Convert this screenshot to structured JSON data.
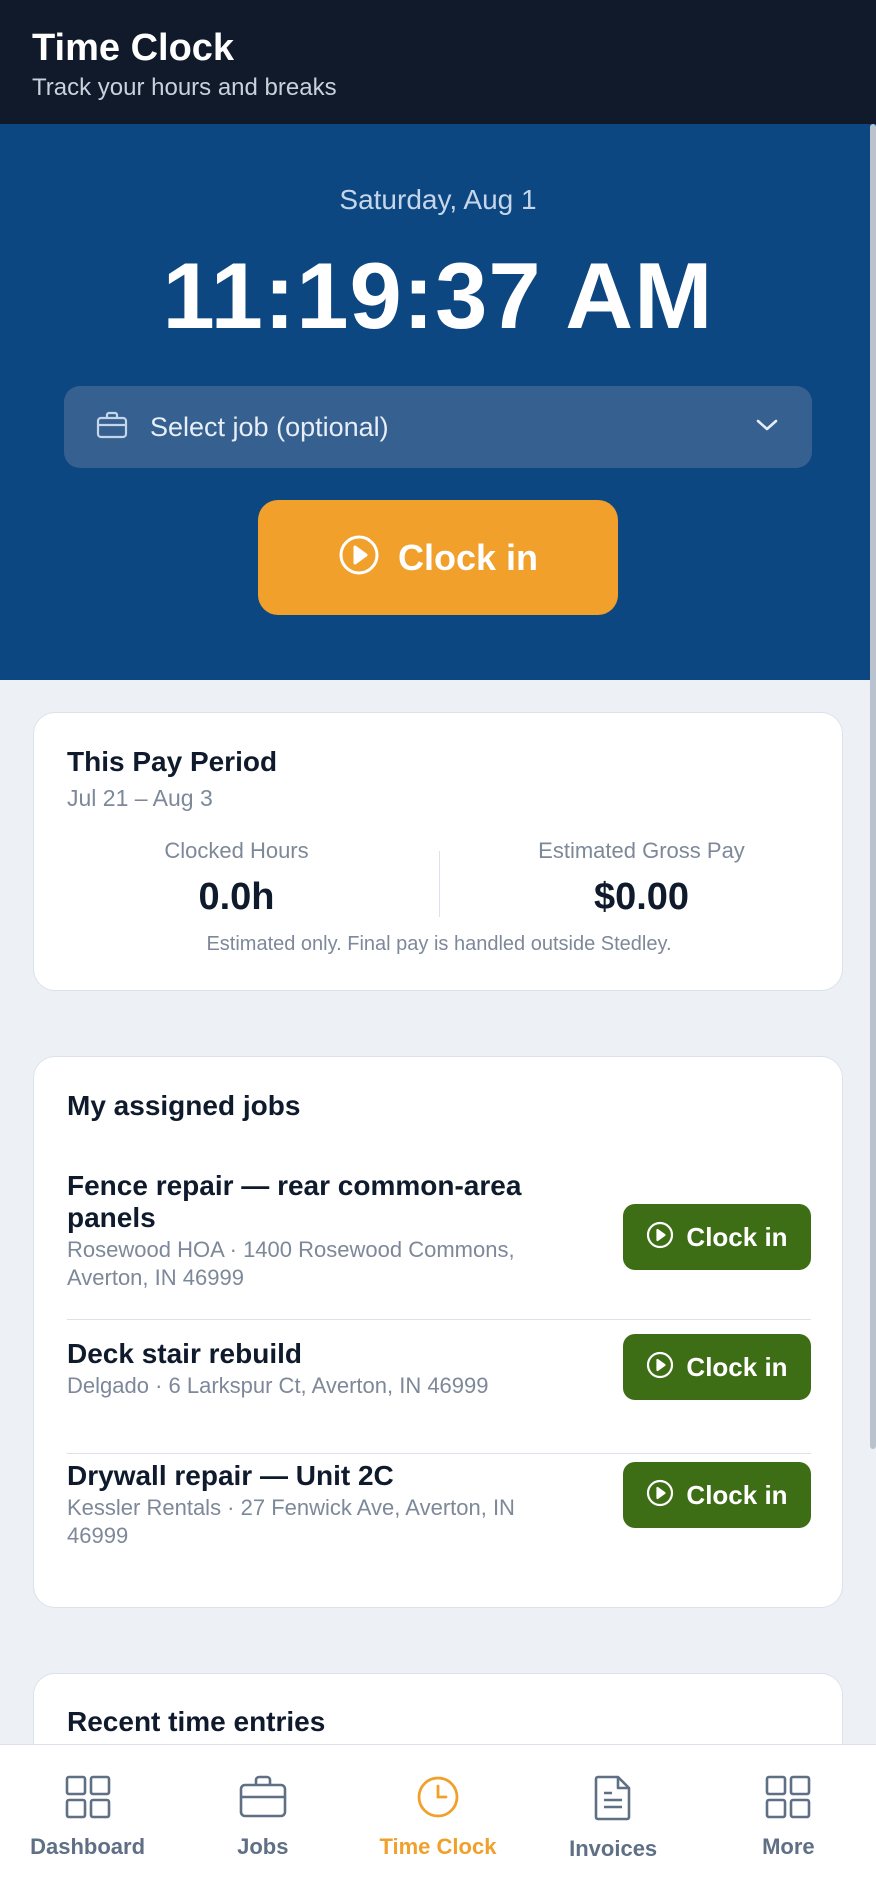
{
  "header": {
    "title": "Time Clock",
    "subtitle": "Track your hours and breaks"
  },
  "hero": {
    "date": "Saturday, Aug 1",
    "time": "11:19:37 AM",
    "job_select_placeholder": "Select job (optional)",
    "clock_in_label": "Clock in"
  },
  "pay_period": {
    "title": "This Pay Period",
    "range": "Jul 21 – Aug 3",
    "hours_label": "Clocked Hours",
    "hours_value": "0.0h",
    "gross_label": "Estimated Gross Pay",
    "gross_value": "$0.00",
    "note": "Estimated only. Final pay is handled outside Stedley."
  },
  "assigned_jobs": {
    "title": "My assigned jobs",
    "items": [
      {
        "title": "Fence repair — rear common-area panels",
        "subtitle": "Rosewood HOA · 1400 Rosewood Commons, Averton, IN 46999",
        "button": "Clock in"
      },
      {
        "title": "Deck stair rebuild",
        "subtitle": "Delgado · 6 Larkspur Ct, Averton, IN 46999",
        "button": "Clock in"
      },
      {
        "title": "Drywall repair — Unit 2C",
        "subtitle": "Kessler Rentals · 27 Fenwick Ave, Averton, IN 46999",
        "button": "Clock in"
      }
    ]
  },
  "recent_entries": {
    "title": "Recent time entries"
  },
  "nav": {
    "items": [
      {
        "label": "Dashboard",
        "icon": "grid-icon",
        "active": false
      },
      {
        "label": "Jobs",
        "icon": "briefcase-icon",
        "active": false
      },
      {
        "label": "Time Clock",
        "icon": "clock-icon",
        "active": true
      },
      {
        "label": "Invoices",
        "icon": "document-icon",
        "active": false
      },
      {
        "label": "More",
        "icon": "grid-icon",
        "active": false
      }
    ]
  },
  "colors": {
    "header_bg": "#101a2a",
    "hero_bg": "#0d4781",
    "accent": "#f0a02b",
    "job_button": "#3d6d14"
  }
}
